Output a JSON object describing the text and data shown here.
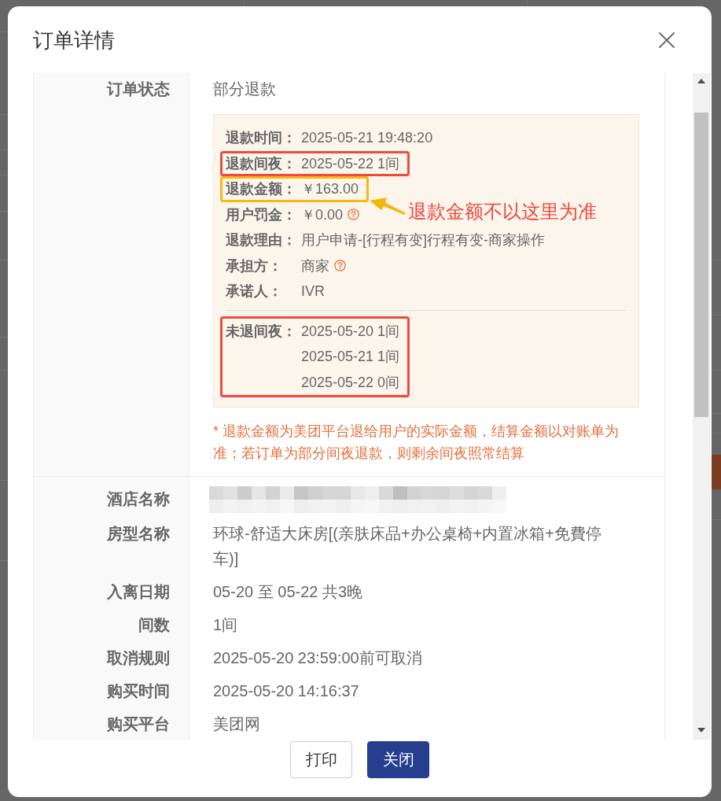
{
  "dialog": {
    "title": "订单详情"
  },
  "order_status": {
    "label": "订单状态",
    "value": "部分退款"
  },
  "refund_details": {
    "rows": [
      {
        "label": "退款时间：",
        "value": "2025-05-21 19:48:20",
        "help_icon": false
      },
      {
        "label": "退款间夜：",
        "value": "2025-05-22 1间",
        "help_icon": false,
        "color": "#ee4a3e"
      },
      {
        "label": "退款金额：",
        "value": "￥163.00",
        "help_icon": false,
        "color": "#fbb612"
      },
      {
        "label": "用户罚金：",
        "value": "￥0.00",
        "help_icon": true
      },
      {
        "label": "退款理由：",
        "value": "用户申请-[行程有变]行程有变-商家操作",
        "help_icon": false
      },
      {
        "label": "承担方：",
        "value": "商家",
        "help_icon": true
      },
      {
        "label": "承诺人：",
        "value": "IVR",
        "help_icon": false
      }
    ],
    "unrefunded_nights": {
      "label": "未退间夜：",
      "values": [
        "2025-05-20 1间",
        "2025-05-21 1间",
        "2025-05-22 0间"
      ],
      "color": "#ee4a3e"
    }
  },
  "annotation": {
    "text": "退款金额不以这里为准"
  },
  "note": "* 退款金额为美团平台退给用户的实际金额，结算金额以对账单为准；若订单为部分间夜退款，则剩余间夜照常结算",
  "info_rows": [
    {
      "kind": "redacted",
      "label": "酒店名称"
    },
    {
      "kind": "text",
      "label": "房型名称",
      "value": "环球-舒适大床房[(亲肤床品+办公桌椅+内置冰箱+免費停车)]"
    },
    {
      "kind": "text",
      "label": "入离日期",
      "value": "05-20 至 05-22 共3晚"
    },
    {
      "kind": "text",
      "label": "间数",
      "value": "1间"
    },
    {
      "kind": "text",
      "label": "取消规则",
      "value": "2025-05-20 23:59:00前可取消"
    },
    {
      "kind": "text",
      "label": "购买时间",
      "value": "2025-05-20 14:16:37"
    },
    {
      "kind": "text",
      "label": "购买平台",
      "value": "美团网"
    }
  ],
  "buttons": [
    {
      "kind": "outline",
      "label": "打印"
    },
    {
      "kind": "filled",
      "label": "关闭"
    }
  ]
}
